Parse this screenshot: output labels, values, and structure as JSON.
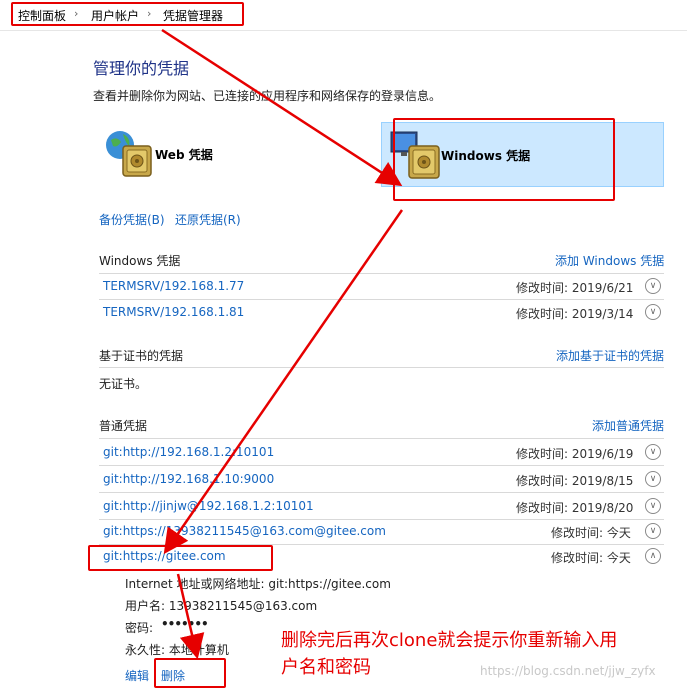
{
  "breadcrumb": {
    "items": [
      "控制面板",
      "用户帐户",
      "凭据管理器"
    ],
    "sep": "›"
  },
  "page": {
    "title": "管理你的凭据",
    "subtitle": "查看并删除你为网站、已连接的应用程序和网络保存的登录信息。"
  },
  "tiles": {
    "web": "Web 凭据",
    "windows": "Windows 凭据"
  },
  "actions": {
    "backup": "备份凭据(B)",
    "restore": "还原凭据(R)"
  },
  "windows_section": {
    "title": "Windows 凭据",
    "add": "添加 Windows 凭据",
    "items": [
      {
        "name": "TERMSRV/192.168.1.77",
        "modified": "修改时间:  2019/6/21"
      },
      {
        "name": "TERMSRV/192.168.1.81",
        "modified": "修改时间:  2019/3/14"
      }
    ]
  },
  "cert_section": {
    "title": "基于证书的凭据",
    "add": "添加基于证书的凭据",
    "empty": "无证书。"
  },
  "generic_section": {
    "title": "普通凭据",
    "add": "添加普通凭据",
    "items": [
      {
        "name": "git:http://192.168.1.2:10101",
        "modified": "修改时间:  2019/6/19"
      },
      {
        "name": "git:http://192.168.1.10:9000",
        "modified": "修改时间:  2019/8/15"
      },
      {
        "name": "git:http://jinjw@192.168.1.2:10101",
        "modified": "修改时间:  2019/8/20"
      },
      {
        "name": "git:https://13938211545@163.com@gitee.com",
        "modified": "修改时间:  今天"
      },
      {
        "name": "git:https://gitee.com",
        "modified": "修改时间:  今天"
      }
    ],
    "expanded": {
      "address": "Internet 地址或网络地址:  git:https://gitee.com",
      "username": "用户名:  13938211545@163.com",
      "password_label": "密码:",
      "password_value": "•••••••",
      "persistence": "永久性:  本地计算机",
      "edit": "编辑",
      "delete": "删除"
    }
  },
  "annotation": {
    "line1": "删除完后再次clone就会提示你重新输入用",
    "line2": "户名和密码"
  },
  "watermark": "https://blog.csdn.net/jjw_zyfx",
  "colors": {
    "link": "#1565c0",
    "title": "#1e3287",
    "highlight": "#cce8ff",
    "red": "#e60000"
  },
  "icons": {
    "tile_web": "globe-safe-icon",
    "tile_windows": "monitor-safe-icon",
    "expand": "chevron-down-icon",
    "collapse": "chevron-up-icon"
  }
}
